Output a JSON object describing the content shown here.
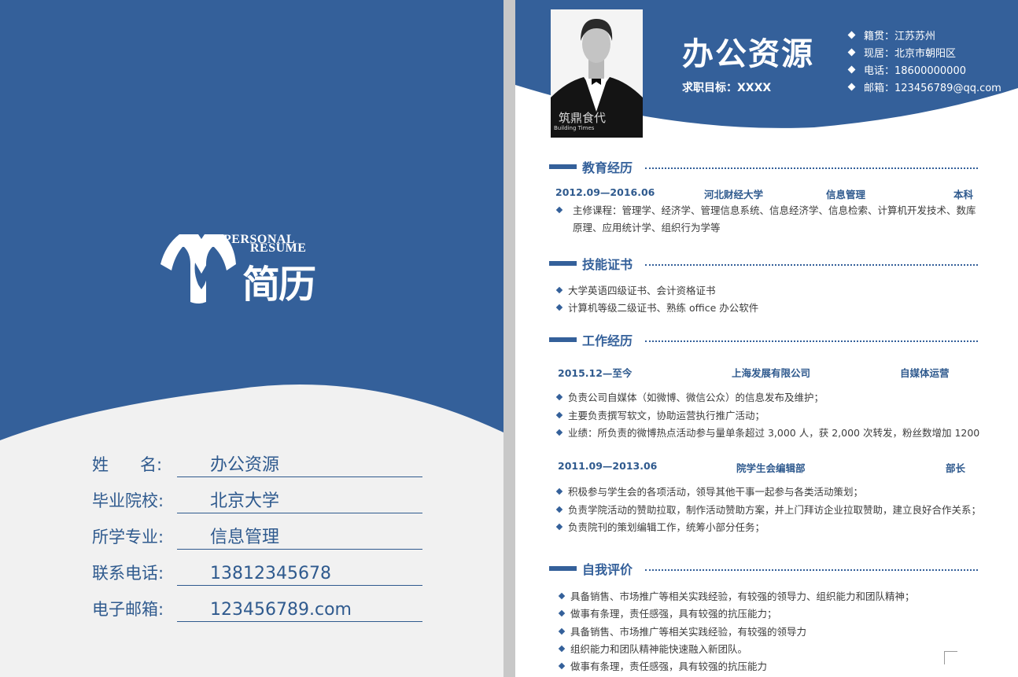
{
  "cover": {
    "logo_en_line1": "PERSONAL",
    "logo_en_line2": "RESUME",
    "logo_cn": "简历",
    "fields": [
      {
        "label": "姓      名:",
        "value": "办公资源"
      },
      {
        "label": "毕业院校:",
        "value": "北京大学"
      },
      {
        "label": "所学专业:",
        "value": "信息管理"
      },
      {
        "label": "联系电话:",
        "value": "13812345678"
      },
      {
        "label": "电子邮箱:",
        "value": "123456789.com"
      }
    ]
  },
  "resume": {
    "name": "办公资源",
    "objective": "求职目标：XXXX",
    "photo_watermark": "筑鼎食代",
    "photo_watermark_sub": "Building Times",
    "contact": [
      "籍贯：江苏苏州",
      "现居：北京市朝阳区",
      "电话：18600000000",
      "邮箱：123456789@qq.com"
    ],
    "education": {
      "title": "教育经历",
      "period": "2012.09—2016.06",
      "school": "河北财经大学",
      "major": "信息管理",
      "degree": "本科",
      "courses": "主修课程：管理学、经济学、管理信息系统、信息经济学、信息检索、计算机开发技术、数库原理、应用统计学、组织行为学等"
    },
    "skills": {
      "title": "技能证书",
      "items": [
        "大学英语四级证书、会计资格证书",
        "计算机等级二级证书、熟练 office 办公软件"
      ]
    },
    "work": {
      "title": "工作经历",
      "jobs": [
        {
          "period": "2015.12—至今",
          "org": "上海发展有限公司",
          "role": "自媒体运营",
          "items": [
            "负责公司自媒体（如微博、微信公众）的信息发布及维护；",
            "主要负责撰写软文，协助运营执行推广活动；",
            "业绩：所负责的微博热点活动参与量单条超过 3,000 人，获 2,000 次转发，粉丝数增加 1200"
          ]
        },
        {
          "period": "2011.09—2013.06",
          "org": "院学生会编辑部",
          "role": "部长",
          "items": [
            "积极参与学生会的各项活动，领导其他干事一起参与各类活动策划；",
            "负责学院活动的赞助拉取，制作活动赞助方案，并上门拜访企业拉取赞助，建立良好合作关系；",
            "负责院刊的策划编辑工作，统筹小部分任务；"
          ]
        }
      ]
    },
    "self_eval": {
      "title": "自我评价",
      "items": [
        "具备销售、市场推广等相关实践经验，有较强的领导力、组织能力和团队精神；",
        "做事有条理，责任感强，具有较强的抗压能力；",
        "具备销售、市场推广等相关实践经验，有较强的领导力",
        "组织能力和团队精神能快速融入新团队。",
        "做事有条理，责任感强，具有较强的抗压能力"
      ]
    },
    "colors": {
      "accent": "#34609a",
      "text": "#3c3c3c"
    }
  }
}
